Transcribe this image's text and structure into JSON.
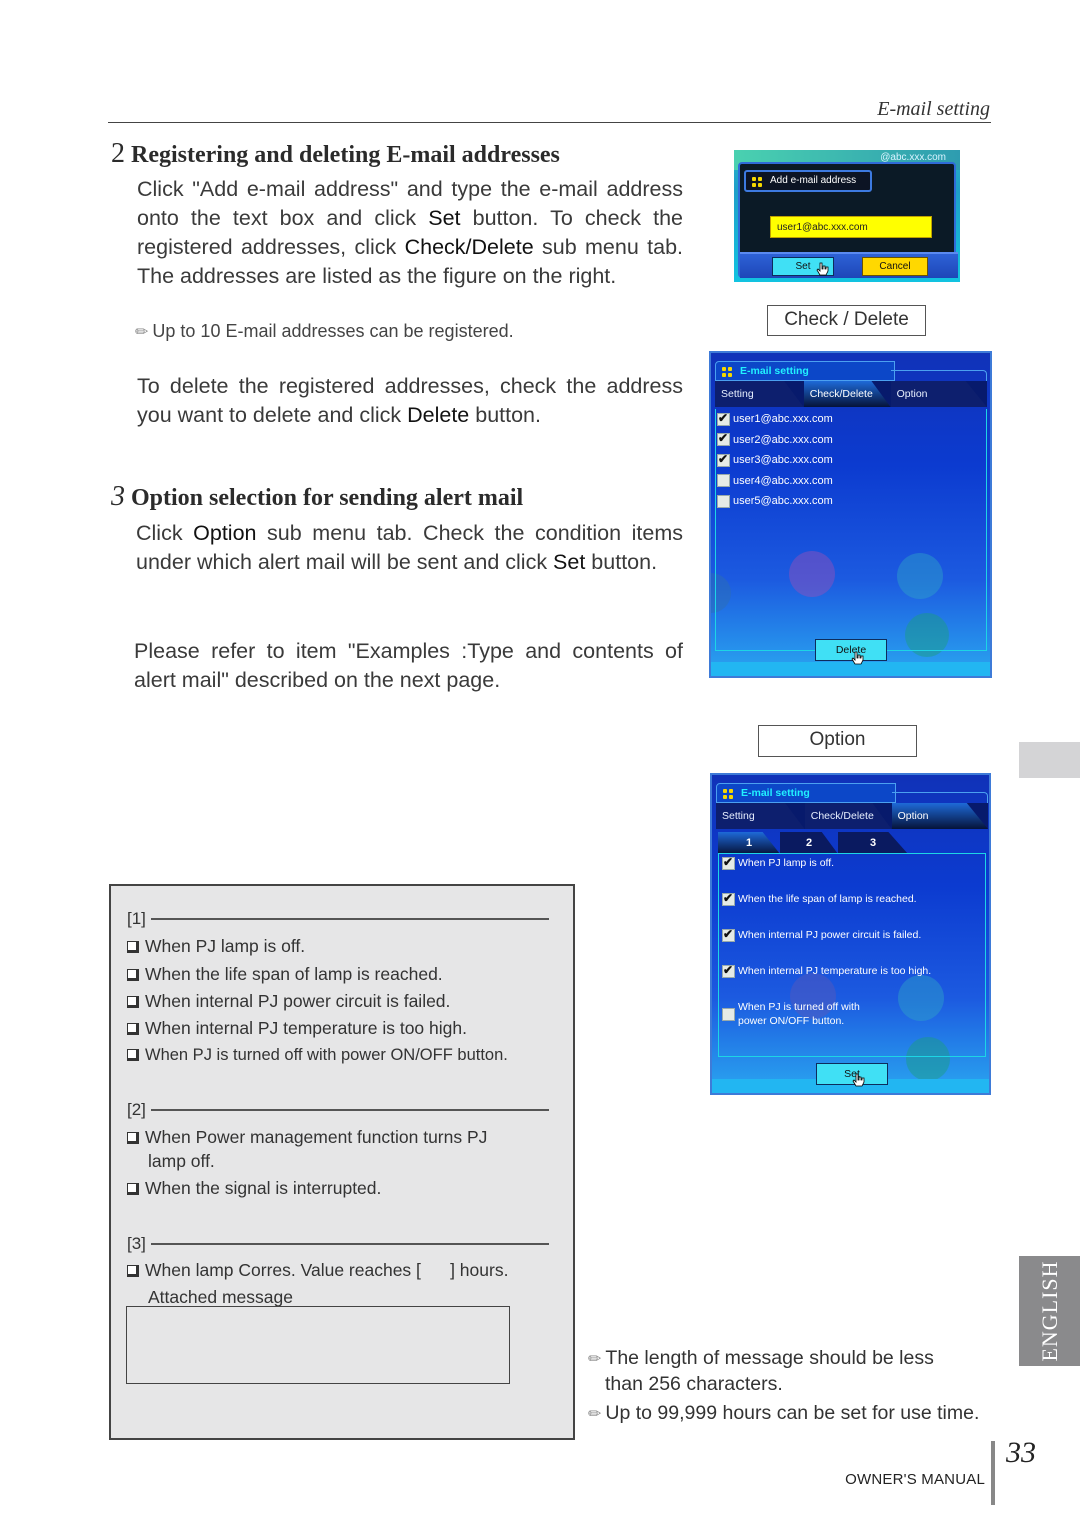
{
  "header": {
    "section_title": "E-mail setting"
  },
  "section2": {
    "number": "2",
    "heading": "Registering and deleting E-mail addresses",
    "paragraph_lines": [
      "Click \"Add e-mail address\" and type the e-mail",
      "address onto the text box and click Set button. To",
      "check the registered addresses, click Check/Delete",
      "sub menu tab. The addresses are listed as the figure",
      "on the right."
    ],
    "p1_a": "Click \"Add e-mail address\" and type the e-mail address onto the text box and click ",
    "p1_set": "Set",
    "p1_b": " button. To check the registered addresses, click ",
    "p1_check": "Check/Delete",
    "p1_c": " sub menu tab. The addresses are listed as the figure on the right.",
    "note": "Up to 10 E-mail addresses can be registered.",
    "p2_a": "To delete the registered addresses, check the address you want to delete and click ",
    "p2_delete": "Delete",
    "p2_b": " button."
  },
  "section3": {
    "number": "3",
    "heading": "Option selection for sending alert mail",
    "p1_a": "Click ",
    "p1_option": "Option",
    "p1_b": " sub menu tab. Check the condition items under which alert mail will be sent and click ",
    "p1_set": "Set",
    "p1_c": " button.",
    "p2": "Please refer to item \"Examples :Type and contents of alert mail\" described on the next page."
  },
  "add_email_panel": {
    "domain_hint": "@abc.xxx.com",
    "title": "Add e-mail address",
    "input_value": "user1@abc.xxx.com",
    "set_label": "Set",
    "cancel_label": "Cancel"
  },
  "captions": {
    "check_delete": "Check / Delete",
    "option": "Option"
  },
  "check_delete_panel": {
    "title": "E-mail setting",
    "tabs": [
      {
        "label": "Setting",
        "active": false
      },
      {
        "label": "Check/Delete",
        "active": true
      },
      {
        "label": "Option",
        "active": false
      }
    ],
    "emails": [
      {
        "address": "user1@abc.xxx.com",
        "checked": true
      },
      {
        "address": "user2@abc.xxx.com",
        "checked": true
      },
      {
        "address": "user3@abc.xxx.com",
        "checked": true
      },
      {
        "address": "user4@abc.xxx.com",
        "checked": false
      },
      {
        "address": "user5@abc.xxx.com",
        "checked": false
      }
    ],
    "delete_label": "Delete"
  },
  "option_panel": {
    "title": "E-mail setting",
    "tabs": [
      {
        "label": "Setting",
        "active": false
      },
      {
        "label": "Check/Delete",
        "active": false
      },
      {
        "label": "Option",
        "active": true
      }
    ],
    "subtabs": [
      {
        "label": "1",
        "active": true
      },
      {
        "label": "2",
        "active": false
      },
      {
        "label": "3",
        "active": false
      }
    ],
    "items": [
      {
        "lines": [
          "When PJ lamp is off."
        ],
        "checked": true
      },
      {
        "lines": [
          "When the life span of lamp is reached."
        ],
        "checked": true
      },
      {
        "lines": [
          "When internal PJ power circuit is failed."
        ],
        "checked": true
      },
      {
        "lines": [
          "When internal PJ temperature is too high."
        ],
        "checked": true
      },
      {
        "lines": [
          "When PJ is turned off with",
          "power ON/OFF button."
        ],
        "checked": false
      }
    ],
    "set_label": "Set"
  },
  "options_box": {
    "groups": [
      {
        "label": "[1]",
        "items": [
          "When PJ lamp is off.",
          "When the life span of lamp is reached.",
          "When internal PJ power circuit is failed.",
          "When internal PJ temperature is too high.",
          "When PJ is turned off with power ON/OFF button."
        ]
      },
      {
        "label": "[2]",
        "items": [
          "When Power management function turns PJ",
          "lamp off.",
          "When the signal is interrupted."
        ]
      },
      {
        "label": "[3]",
        "items": [
          "When lamp Corres. Value reaches [      ] hours.",
          "Attached message"
        ]
      }
    ]
  },
  "notes": {
    "message_length_1": "The length of message should be less",
    "message_length_2": "than 256 characters.",
    "hours": "Up to 99,999 hours can be set for use time."
  },
  "side": {
    "language_tab": "ENGLISH"
  },
  "footer": {
    "page_number": "33",
    "manual_label": "OWNER'S MANUAL"
  }
}
